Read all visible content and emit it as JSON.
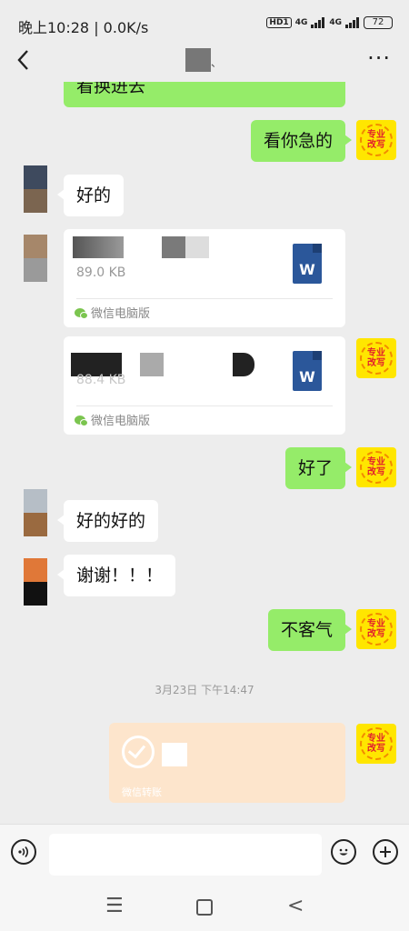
{
  "status_bar": {
    "time": "晚上10:28 | 0.0K/s",
    "hd": "HD1",
    "net_a": "4G",
    "net_b": "4G",
    "battery": "72"
  },
  "header": {
    "back_icon": "chevron-left-icon",
    "title_suffix": "、",
    "more": "···"
  },
  "messages": [
    {
      "side": "right",
      "text": "看换进去"
    },
    {
      "side": "right",
      "text": "看你急的"
    },
    {
      "side": "left",
      "text": "好的"
    },
    {
      "side": "left",
      "type": "file",
      "file_name": "石",
      "file_size": "89.0 KB",
      "source": "微信电脑版"
    },
    {
      "side": "right",
      "type": "file",
      "file_size": "88.4 KB",
      "source": "微信电脑版"
    },
    {
      "side": "right",
      "text": "好了"
    },
    {
      "side": "left",
      "text": "好的好的"
    },
    {
      "side": "left",
      "text": "谢谢！！！"
    },
    {
      "side": "right",
      "text": "不客气"
    }
  ],
  "timestamp": "3月23日 下午14:47",
  "transfer": {
    "label": "微信转账"
  },
  "badge": {
    "line1": "专业",
    "line2": "改写"
  },
  "input_bar": {
    "voice_icon": "voice-icon",
    "emoji_icon": "emoji-icon",
    "plus_icon": "plus-icon"
  },
  "nav": {
    "menu": "☰",
    "back": "<"
  },
  "colors": {
    "green_bubble": "#95ec69",
    "badge_yellow": "#ffe600",
    "transfer_orange": "#fde5cc"
  }
}
